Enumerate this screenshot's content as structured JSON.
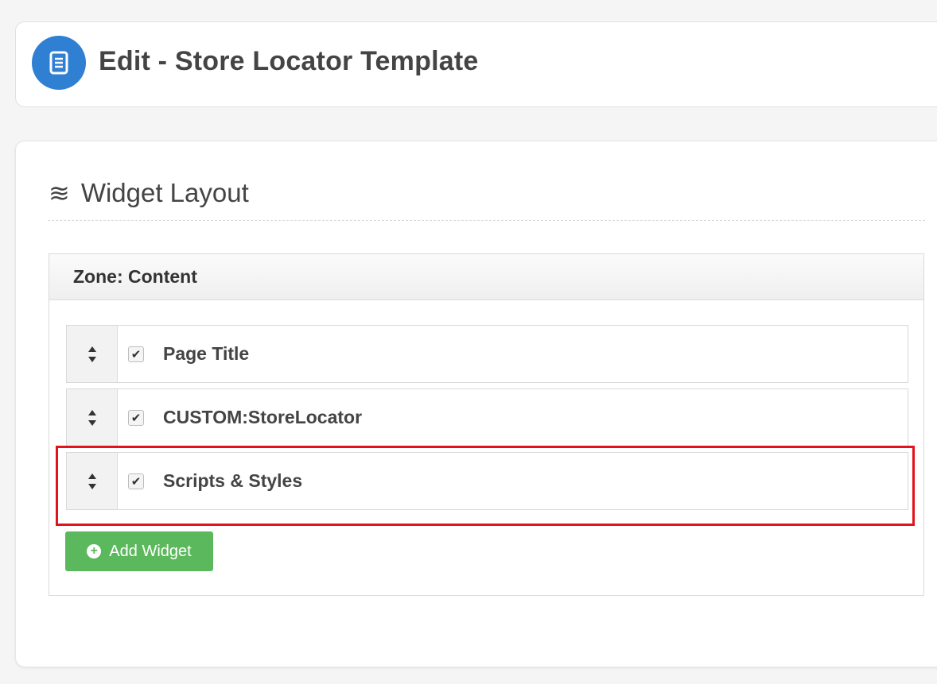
{
  "header": {
    "title": "Edit - Store Locator Template",
    "icon": "document-icon",
    "icon_color": "#2f7fd3"
  },
  "widget_layout": {
    "title": "Widget Layout",
    "icon": "wave-lines-icon"
  },
  "zone": {
    "title": "Zone: Content",
    "widgets": [
      {
        "label": "Page Title",
        "checked": true
      },
      {
        "label": "CUSTOM:StoreLocator",
        "checked": true
      },
      {
        "label": "Scripts & Styles",
        "checked": true
      }
    ]
  },
  "actions": {
    "add_widget_label": "Add Widget",
    "add_widget_color": "#5cb85c"
  },
  "highlight_color": "#e2141b"
}
